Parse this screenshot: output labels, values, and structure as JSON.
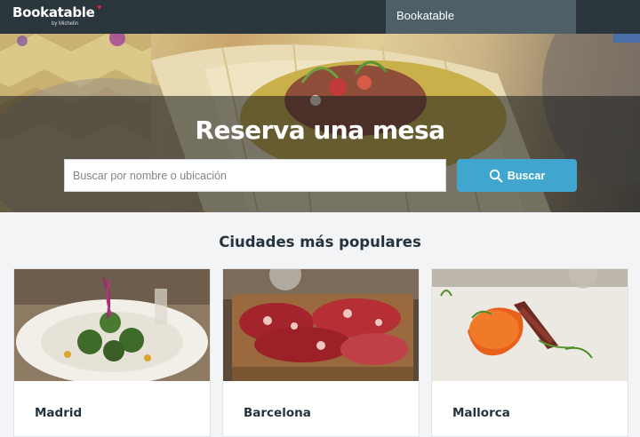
{
  "header": {
    "logo_text": "Bookatable",
    "logo_sub": "by Michelin",
    "nav_brand": "Bookatable"
  },
  "hero": {
    "title": "Reserva una mesa",
    "search_placeholder": "Buscar por nombre o ubicación",
    "search_button": "Buscar"
  },
  "popular": {
    "title": "Ciudades más populares",
    "cities": [
      {
        "name": "Madrid"
      },
      {
        "name": "Barcelona"
      },
      {
        "name": "Mallorca"
      }
    ]
  },
  "colors": {
    "topbar": "#2a353c",
    "nav_active": "#4e5f68",
    "accent": "#41a6cf",
    "heart": "#d72638"
  }
}
